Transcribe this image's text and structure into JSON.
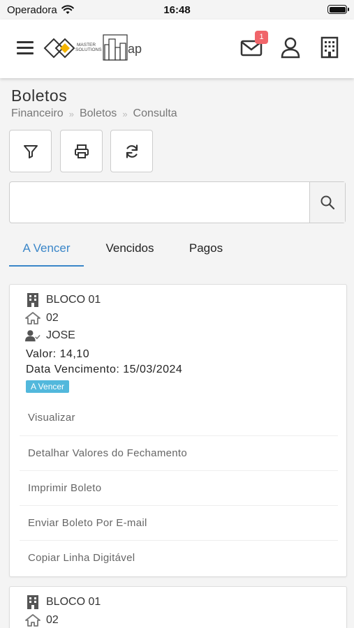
{
  "status_bar": {
    "carrier": "Operadora",
    "time": "16:48"
  },
  "header": {
    "logo_text_top": "MASTER",
    "logo_text_bottom": "SOLUTIONS",
    "logo_suffix": "ap",
    "mail_badge": "1"
  },
  "page": {
    "title": "Boletos",
    "breadcrumb": [
      "Financeiro",
      "Boletos",
      "Consulta"
    ]
  },
  "search": {
    "value": "",
    "placeholder": ""
  },
  "tabs": [
    {
      "label": "A Vencer",
      "active": true
    },
    {
      "label": "Vencidos",
      "active": false
    },
    {
      "label": "Pagos",
      "active": false
    }
  ],
  "boletos": [
    {
      "bloco": "BLOCO 01",
      "unidade": "02",
      "morador": "JOSE",
      "valor_label": "Valor:",
      "valor": "14,10",
      "vencimento_label": "Data Vencimento:",
      "vencimento": "15/03/2024",
      "status": "A Vencer",
      "actions": [
        "Visualizar",
        "Detalhar Valores do Fechamento",
        "Imprimir Boleto",
        "Enviar Boleto Por E-mail",
        "Copiar Linha Digitável"
      ]
    },
    {
      "bloco": "BLOCO 01",
      "unidade": "02"
    }
  ],
  "colors": {
    "accent": "#3a86c8",
    "badge": "#f0656a",
    "status_pill": "#52b8dc"
  }
}
